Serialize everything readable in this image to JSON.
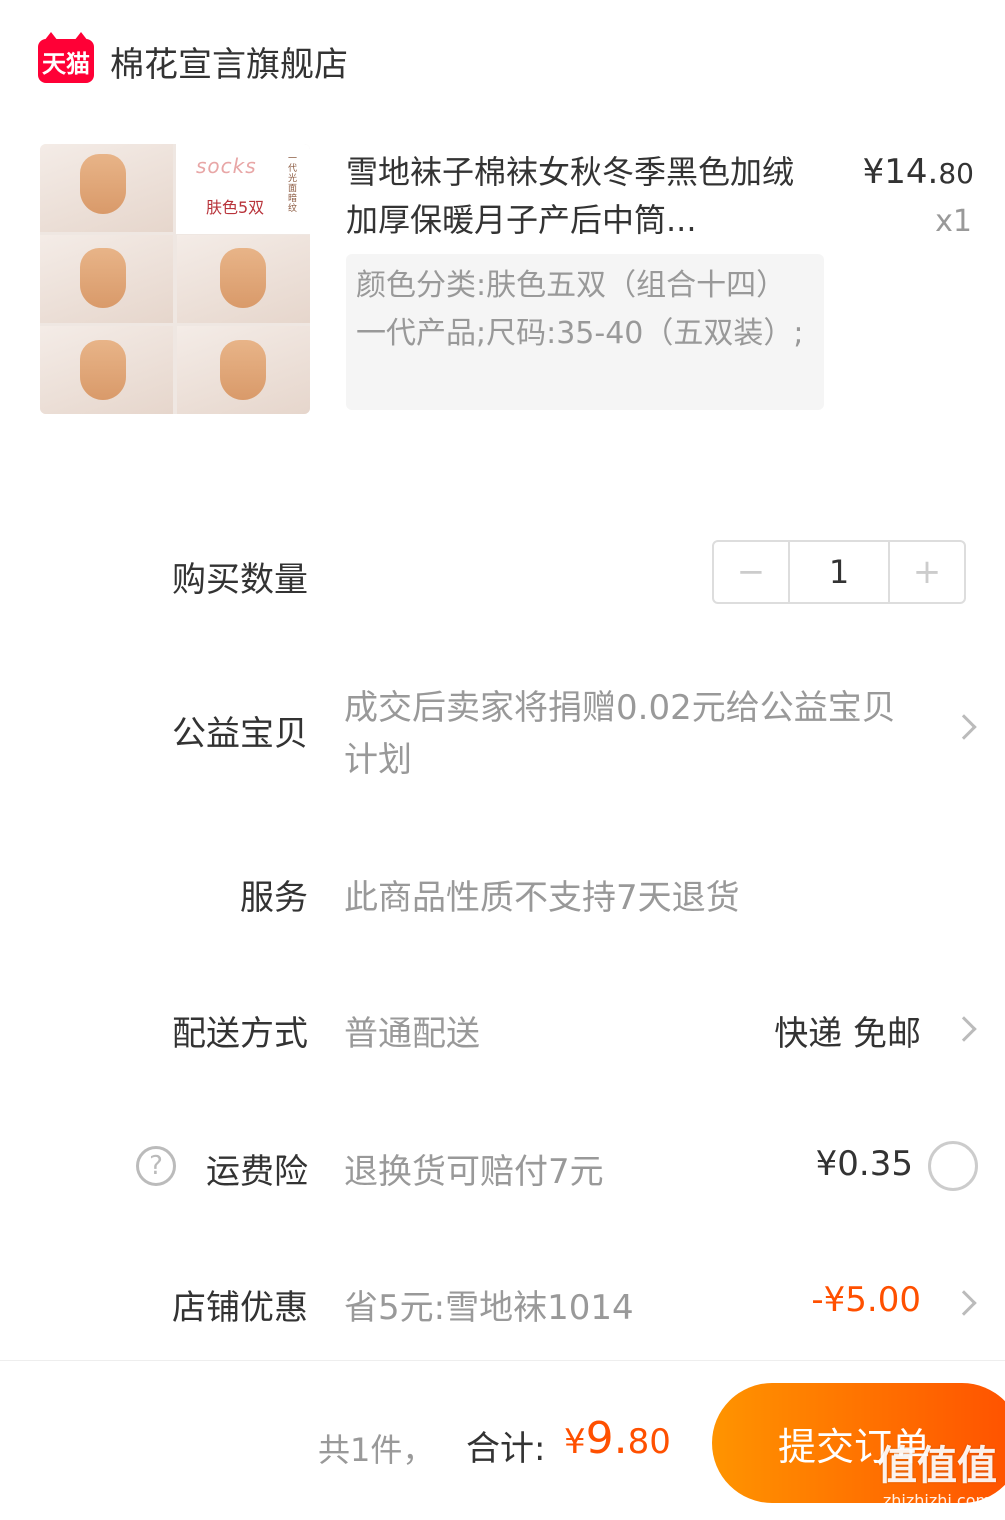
{
  "store": {
    "badge": "天猫",
    "name": "棉花宣言旗舰店"
  },
  "product": {
    "thumbnail_logo": "socks",
    "thumbnail_text": "肤色5双",
    "thumbnail_side_text": "一代光面暗纹",
    "title": "雪地袜子棉袜女秋冬季黑色加绒加厚保暖月子产后中筒...",
    "price_symbol": "¥",
    "price_main": "14.",
    "price_cents": "80",
    "quantity_label": "x1",
    "spec": "颜色分类:肤色五双（组合十四）一代产品;尺码:35-40（五双装）;"
  },
  "quantity": {
    "label": "购买数量",
    "minus": "−",
    "value": "1",
    "plus": "+"
  },
  "charity": {
    "label": "公益宝贝",
    "desc": "成交后卖家将捐赠0.02元给公益宝贝计划"
  },
  "service": {
    "label": "服务",
    "desc": "此商品性质不支持7天退货"
  },
  "delivery": {
    "label": "配送方式",
    "desc": "普通配送",
    "value": "快递 免邮"
  },
  "insurance": {
    "help": "?",
    "label": "运费险",
    "desc": "退换货可赔付7元",
    "value": "¥0.35"
  },
  "discount": {
    "label": "店铺优惠",
    "desc": "省5元:雪地袜1014",
    "value": "-¥5.00"
  },
  "footer": {
    "count": "共1件，",
    "total_label": "合计:",
    "total_currency": "¥",
    "total_main": "9.",
    "total_cents": "80",
    "submit": "提交订单",
    "watermark_big": "值值值",
    "watermark_small": "zhizhizhi.com"
  },
  "colors": {
    "accent": "#ff5000",
    "tmall": "#ff0036",
    "muted": "#999999"
  }
}
